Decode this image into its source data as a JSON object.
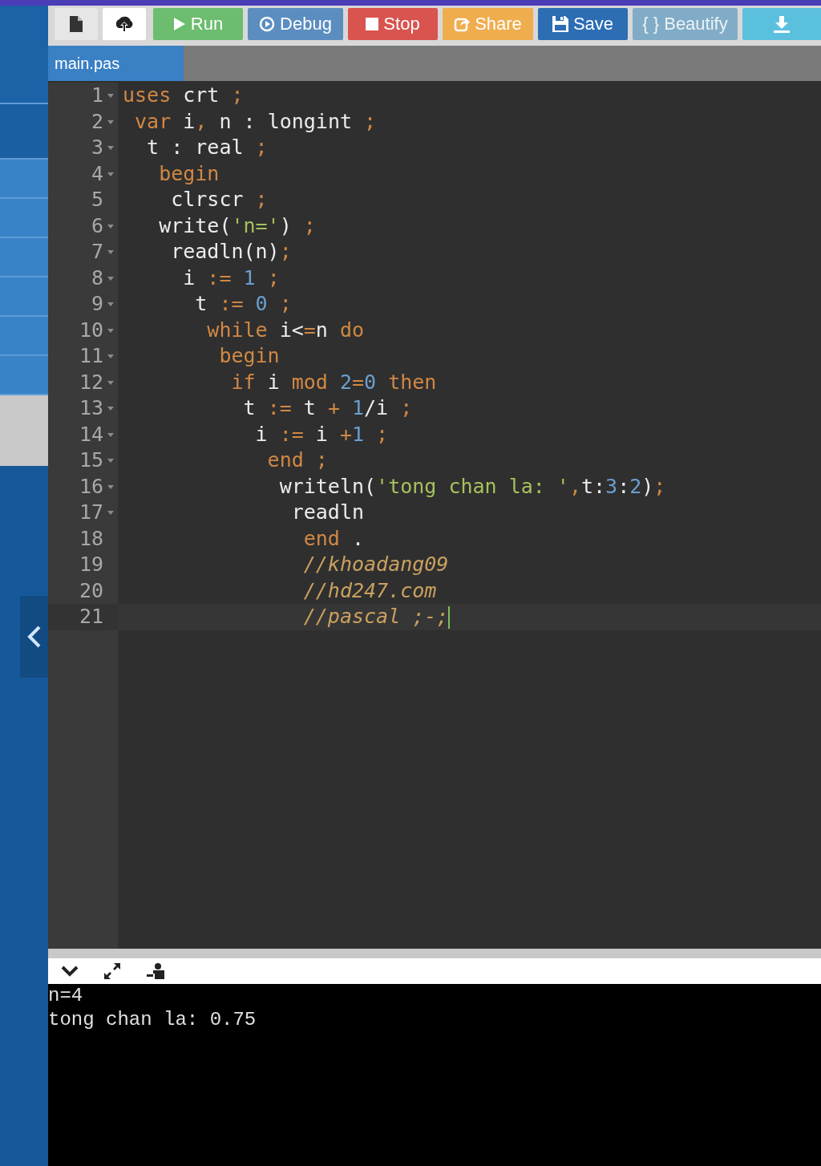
{
  "toolbar": {
    "buttons": [
      {
        "kind": "new-file",
        "disabled": false
      },
      {
        "kind": "upload",
        "disabled": false
      },
      {
        "kind": "run",
        "label": "Run",
        "disabled": false
      },
      {
        "kind": "debug",
        "label": "Debug",
        "disabled": false
      },
      {
        "kind": "stop",
        "label": "Stop",
        "disabled": false
      },
      {
        "kind": "share",
        "label": "Share",
        "disabled": false
      },
      {
        "kind": "save",
        "label": "Save",
        "disabled": false
      },
      {
        "kind": "beautify",
        "label": "{ } Beautify",
        "disabled": true
      },
      {
        "kind": "download",
        "disabled": false
      }
    ]
  },
  "tabs": [
    {
      "label": "main.pas",
      "selected": true
    }
  ],
  "editor": {
    "lines": [
      {
        "number": "1",
        "foldable": true,
        "active": false,
        "tokens": [
          {
            "kind": "keyword",
            "text": "uses"
          },
          {
            "kind": "plain",
            "text": " crt "
          },
          {
            "kind": "operator",
            "text": ";"
          }
        ]
      },
      {
        "number": "2",
        "foldable": true,
        "active": false,
        "tokens": [
          {
            "kind": "keyword",
            "text": " var"
          },
          {
            "kind": "plain",
            "text": " i"
          },
          {
            "kind": "operator",
            "text": ","
          },
          {
            "kind": "plain",
            "text": " n : longint "
          },
          {
            "kind": "operator",
            "text": ";"
          }
        ]
      },
      {
        "number": "3",
        "foldable": true,
        "active": false,
        "tokens": [
          {
            "kind": "plain",
            "text": "  t : real "
          },
          {
            "kind": "operator",
            "text": ";"
          }
        ]
      },
      {
        "number": "4",
        "foldable": true,
        "active": false,
        "tokens": [
          {
            "kind": "keyword",
            "text": "   begin"
          }
        ]
      },
      {
        "number": "5",
        "foldable": false,
        "active": false,
        "tokens": [
          {
            "kind": "plain",
            "text": "    clrscr "
          },
          {
            "kind": "operator",
            "text": ";"
          }
        ]
      },
      {
        "number": "6",
        "foldable": true,
        "active": false,
        "tokens": [
          {
            "kind": "plain",
            "text": "   write("
          },
          {
            "kind": "string",
            "text": "'n='"
          },
          {
            "kind": "plain",
            "text": ") "
          },
          {
            "kind": "operator",
            "text": ";"
          }
        ]
      },
      {
        "number": "7",
        "foldable": true,
        "active": false,
        "tokens": [
          {
            "kind": "plain",
            "text": "    readln(n)"
          },
          {
            "kind": "operator",
            "text": ";"
          }
        ]
      },
      {
        "number": "8",
        "foldable": true,
        "active": false,
        "tokens": [
          {
            "kind": "plain",
            "text": "     i "
          },
          {
            "kind": "operator",
            "text": ":="
          },
          {
            "kind": "number",
            "text": " 1"
          },
          {
            "kind": "operator",
            "text": " ;"
          }
        ]
      },
      {
        "number": "9",
        "foldable": true,
        "active": false,
        "tokens": [
          {
            "kind": "plain",
            "text": "      t "
          },
          {
            "kind": "operator",
            "text": ":="
          },
          {
            "kind": "number",
            "text": " 0"
          },
          {
            "kind": "operator",
            "text": " ;"
          }
        ]
      },
      {
        "number": "10",
        "foldable": true,
        "active": false,
        "tokens": [
          {
            "kind": "keyword",
            "text": "       while"
          },
          {
            "kind": "plain",
            "text": " i<"
          },
          {
            "kind": "operator",
            "text": "="
          },
          {
            "kind": "plain",
            "text": "n "
          },
          {
            "kind": "keyword",
            "text": "do"
          }
        ]
      },
      {
        "number": "11",
        "foldable": true,
        "active": false,
        "tokens": [
          {
            "kind": "keyword",
            "text": "        begin"
          }
        ]
      },
      {
        "number": "12",
        "foldable": true,
        "active": false,
        "tokens": [
          {
            "kind": "keyword",
            "text": "         if"
          },
          {
            "kind": "plain",
            "text": " i "
          },
          {
            "kind": "keyword",
            "text": "mod"
          },
          {
            "kind": "number",
            "text": " 2"
          },
          {
            "kind": "operator",
            "text": "="
          },
          {
            "kind": "number",
            "text": "0"
          },
          {
            "kind": "keyword",
            "text": " then"
          }
        ]
      },
      {
        "number": "13",
        "foldable": true,
        "active": false,
        "tokens": [
          {
            "kind": "plain",
            "text": "          t "
          },
          {
            "kind": "operator",
            "text": ":="
          },
          {
            "kind": "plain",
            "text": " t "
          },
          {
            "kind": "operator",
            "text": "+"
          },
          {
            "kind": "number",
            "text": " 1"
          },
          {
            "kind": "plain",
            "text": "/i "
          },
          {
            "kind": "operator",
            "text": ";"
          }
        ]
      },
      {
        "number": "14",
        "foldable": true,
        "active": false,
        "tokens": [
          {
            "kind": "plain",
            "text": "           i "
          },
          {
            "kind": "operator",
            "text": ":="
          },
          {
            "kind": "plain",
            "text": " i "
          },
          {
            "kind": "operator",
            "text": "+"
          },
          {
            "kind": "number",
            "text": "1"
          },
          {
            "kind": "operator",
            "text": " ;"
          }
        ]
      },
      {
        "number": "15",
        "foldable": true,
        "active": false,
        "tokens": [
          {
            "kind": "keyword",
            "text": "            end"
          },
          {
            "kind": "operator",
            "text": " ;"
          }
        ]
      },
      {
        "number": "16",
        "foldable": true,
        "active": false,
        "tokens": [
          {
            "kind": "plain",
            "text": "             writeln("
          },
          {
            "kind": "string",
            "text": "'tong chan la: '"
          },
          {
            "kind": "operator",
            "text": ","
          },
          {
            "kind": "plain",
            "text": "t:"
          },
          {
            "kind": "number",
            "text": "3"
          },
          {
            "kind": "plain",
            "text": ":"
          },
          {
            "kind": "number",
            "text": "2"
          },
          {
            "kind": "plain",
            "text": ")"
          },
          {
            "kind": "operator",
            "text": ";"
          }
        ]
      },
      {
        "number": "17",
        "foldable": true,
        "active": false,
        "tokens": [
          {
            "kind": "plain",
            "text": "              readln"
          }
        ]
      },
      {
        "number": "18",
        "foldable": false,
        "active": false,
        "tokens": [
          {
            "kind": "keyword",
            "text": "               end"
          },
          {
            "kind": "plain",
            "text": " ."
          }
        ]
      },
      {
        "number": "19",
        "foldable": false,
        "active": false,
        "tokens": [
          {
            "kind": "comment",
            "text": "               //khoadang09"
          }
        ]
      },
      {
        "number": "20",
        "foldable": false,
        "active": false,
        "tokens": [
          {
            "kind": "comment",
            "text": "               //hd247.com"
          }
        ]
      },
      {
        "number": "21",
        "foldable": false,
        "active": true,
        "tokens": [
          {
            "kind": "comment",
            "text": "               //pascal ;-;"
          }
        ]
      }
    ]
  },
  "console": {
    "lines": [
      "n=4",
      "tong chan la: 0.75"
    ]
  }
}
